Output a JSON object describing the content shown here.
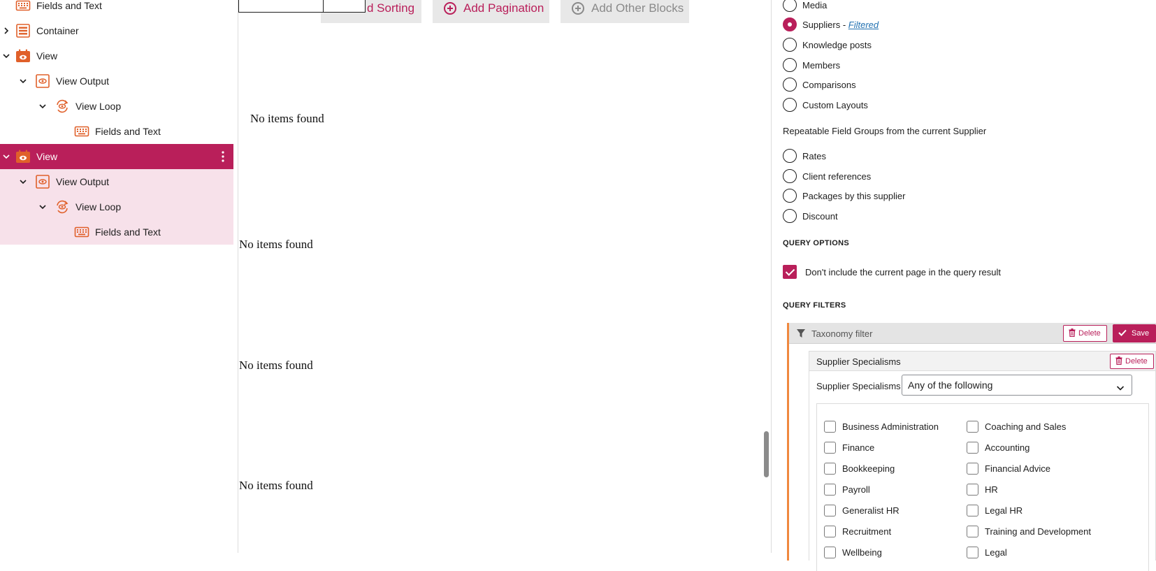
{
  "list_view": {
    "rows": [
      {
        "label": "Fields and Text"
      },
      {
        "label": "Container"
      },
      {
        "label": "View"
      },
      {
        "label": "View Output"
      },
      {
        "label": "View Loop"
      },
      {
        "label": "Fields and Text"
      },
      {
        "label": "View"
      },
      {
        "label": "View Output"
      },
      {
        "label": "View Loop"
      },
      {
        "label": "Fields and Text"
      }
    ],
    "accent": "#b91f5a",
    "icon_color": "#e0602a"
  },
  "canvas": {
    "buttons": [
      {
        "label": "d Sorting"
      },
      {
        "label": "Add Pagination"
      },
      {
        "label": "Add Other Blocks"
      }
    ],
    "empty_messages": [
      "No items found",
      "No items found",
      "No items found",
      "No items found"
    ]
  },
  "settings": {
    "post_types": [
      {
        "label": "Media",
        "checked": false
      },
      {
        "label": "Suppliers",
        "suffix": " - ",
        "link": "Filtered",
        "checked": true
      },
      {
        "label": "Knowledge posts",
        "checked": false
      },
      {
        "label": "Members",
        "checked": false
      },
      {
        "label": "Comparisons",
        "checked": false
      },
      {
        "label": "Custom Layouts",
        "checked": false
      }
    ],
    "repeatable_heading": "Repeatable Field Groups from the current Supplier",
    "repeatable_groups": [
      {
        "label": "Rates"
      },
      {
        "label": "Client references"
      },
      {
        "label": "Packages by this supplier"
      },
      {
        "label": "Discount"
      }
    ],
    "query_options_heading": "QUERY OPTIONS",
    "exclude_current_label": "Don't include the current page in the query result",
    "exclude_current_checked": true,
    "query_filters_heading": "QUERY FILTERS",
    "taxonomy_filter": {
      "title": "Taxonomy filter",
      "delete_label": "Delete",
      "save_label": "Save",
      "taxonomy": {
        "title": "Supplier Specialisms",
        "delete_label": "Delete",
        "condition_label": "Supplier Specialisms are:",
        "condition_value": "Any of the following",
        "terms_left": [
          "Business Administration",
          "Finance",
          "Bookkeeping",
          "Payroll",
          "Generalist HR",
          "Recruitment",
          "Wellbeing"
        ],
        "terms_right": [
          "Coaching and Sales",
          "Accounting",
          "Financial Advice",
          "HR",
          "Legal HR",
          "Training and Development",
          "Legal"
        ]
      }
    }
  }
}
